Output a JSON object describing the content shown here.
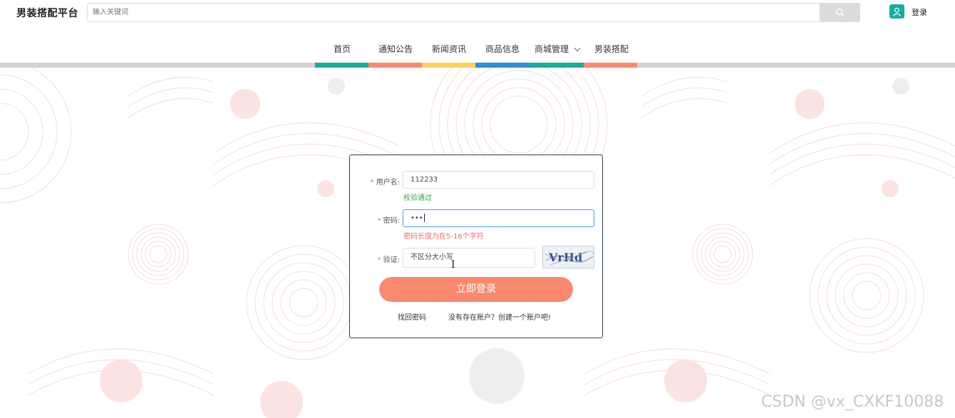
{
  "header": {
    "site_title": "男装搭配平台",
    "search_placeholder": "输入关键词",
    "login_label": "登录"
  },
  "nav": {
    "items": [
      "首页",
      "通知公告",
      "新闻资讯",
      "商品信息",
      "商城管理",
      "男装搭配"
    ],
    "stripe_colors": [
      "#1aac9c",
      "#f98a6f",
      "#fdd15e",
      "#2f8fdb",
      "#1aac9c",
      "#f98a6f"
    ]
  },
  "form": {
    "username_label": "用户名:",
    "username_value": "112233",
    "username_msg": "校验通过",
    "password_label": "密码:",
    "password_value": "•••",
    "password_msg": "密码长度为在5-16个字符",
    "captcha_label": "验证:",
    "captcha_value": "不区分大小写",
    "captcha_text": "VrHd",
    "submit_label": "立即登录",
    "forgot_label": "找回密码",
    "register_label": "没有存在账户？创建一个账户吧!"
  },
  "watermark": "CSDN @vx_CXKF10088",
  "colors": {
    "accent": "#f98a6f",
    "teal": "#1aac9c",
    "error": "#f56c6c",
    "success": "#3aa34b"
  }
}
